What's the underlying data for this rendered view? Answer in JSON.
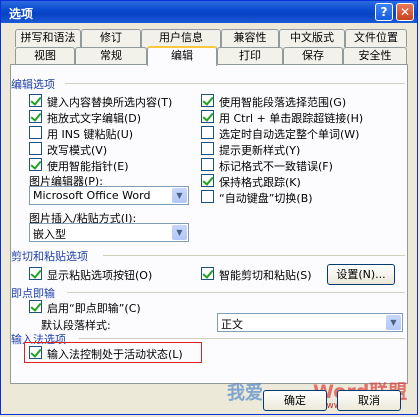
{
  "window": {
    "title": "选项",
    "help_glyph": "?",
    "close_glyph": "✕"
  },
  "tabs_top": [
    "拼写和语法",
    "修订",
    "用户信息",
    "兼容性",
    "中文版式",
    "文件位置"
  ],
  "tabs_bottom": [
    "视图",
    "常规",
    "编辑",
    "打印",
    "保存",
    "安全性"
  ],
  "active_tab": "编辑",
  "edit_options": {
    "title": "编辑选项",
    "left": [
      {
        "label": "键入内容替换所选内容(T)",
        "checked": true
      },
      {
        "label": "拖放式文字编辑(D)",
        "checked": true
      },
      {
        "label": "用 INS 键粘贴(U)",
        "checked": false
      },
      {
        "label": "改写模式(V)",
        "checked": false
      },
      {
        "label": "使用智能指针(E)",
        "checked": true
      }
    ],
    "right": [
      {
        "label": "使用智能段落选择范围(G)",
        "checked": true
      },
      {
        "label": "用 Ctrl + 单击跟踪超链接(H)",
        "checked": true
      },
      {
        "label": "选定时自动选定整个单词(W)",
        "checked": false
      },
      {
        "label": "提示更新样式(Y)",
        "checked": false
      },
      {
        "label": "标记格式不一致错误(F)",
        "checked": false
      },
      {
        "label": "保持格式跟踪(K)",
        "checked": true
      },
      {
        "label": "“自动键盘”切换(B)",
        "checked": false
      }
    ],
    "picture_editor_label": "图片编辑器(P):",
    "picture_editor_value": "Microsoft Office Word",
    "insert_label": "图片插入/粘贴方式(I):",
    "insert_value": "嵌入型"
  },
  "cut_paste": {
    "title": "剪切和粘贴选项",
    "show_buttons": {
      "label": "显示粘贴选项按钮(O)",
      "checked": true
    },
    "smart_cut": {
      "label": "智能剪切和粘贴(S)",
      "checked": true
    },
    "settings_button": "设置(N)..."
  },
  "click_type": {
    "title": "即点即输",
    "enable": {
      "label": "启用“即点即输”(C)",
      "checked": true
    },
    "default_style_label": "默认段落样式:",
    "default_style_value": "正文"
  },
  "ime": {
    "title": "输入法选项",
    "ime_control": {
      "label": "输入法控制处于活动状态(L)",
      "checked": true
    }
  },
  "buttons": {
    "ok": "确定",
    "cancel": "取消"
  },
  "watermark": {
    "text1": "我爱",
    "text2": "Word联盟",
    "url": "www.wordlm.com"
  }
}
